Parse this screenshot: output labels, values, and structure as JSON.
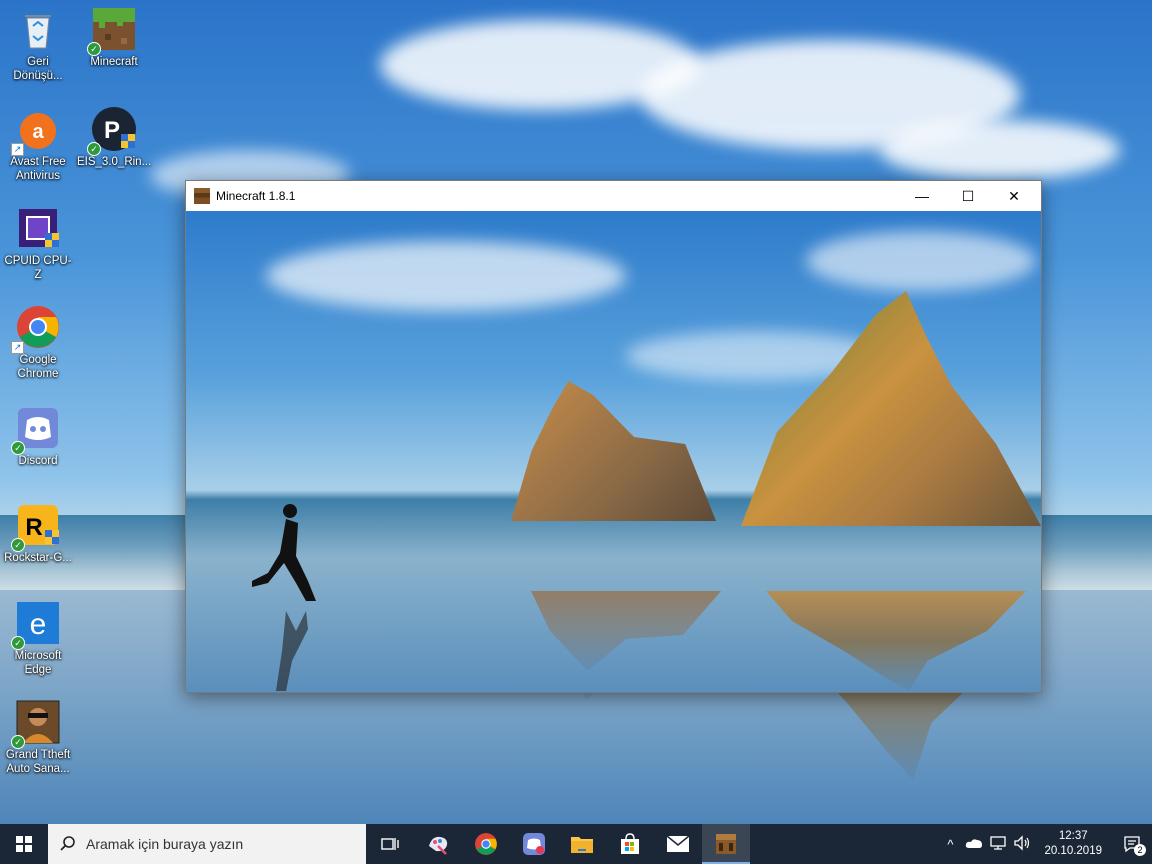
{
  "desktop": {
    "icons": [
      {
        "label": "Geri Dönüşü..."
      },
      {
        "label": "Minecraft"
      },
      {
        "label": "Avast Free Antivirus"
      },
      {
        "label": "EIS_3.0_Rin..."
      },
      {
        "label": "CPUID CPU-Z"
      },
      {
        "label": "Google Chrome"
      },
      {
        "label": "Discord"
      },
      {
        "label": "Rockstar-G..."
      },
      {
        "label": "Microsoft Edge"
      },
      {
        "label": "Grand Ttheft Auto Sana..."
      }
    ]
  },
  "window": {
    "title": "Minecraft 1.8.1",
    "minimize": "—",
    "maximize": "☐",
    "close": "✕"
  },
  "taskbar": {
    "search_placeholder": "Aramak için buraya yazın",
    "tray_chevron": "^",
    "time": "12:37",
    "date": "20.10.2019",
    "notification_count": "2"
  },
  "colors": {
    "taskbar_bg": "#1b2736",
    "accent": "#7fb0e6"
  }
}
